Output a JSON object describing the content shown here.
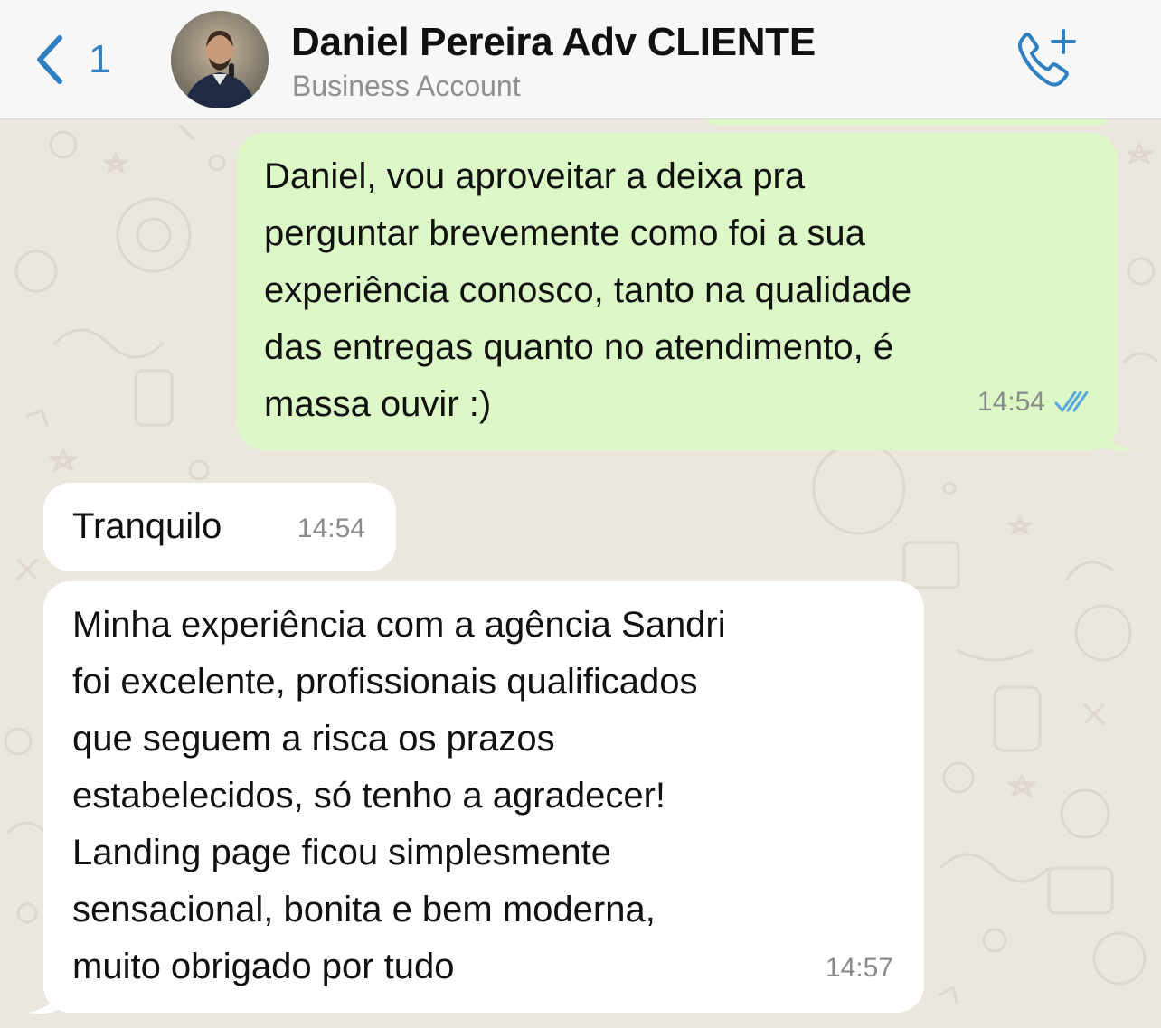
{
  "header": {
    "back_count": "1",
    "contact_name": "Daniel Pereira Adv CLIENTE",
    "contact_subtitle": "Business Account"
  },
  "icons": {
    "back": "chevron-left-icon",
    "call": "phone-plus-icon",
    "read_receipt": "double-check-icon"
  },
  "colors": {
    "accent": "#2f7fc1",
    "outgoing_bubble": "#dcf8c6",
    "incoming_bubble": "#ffffff",
    "chat_background": "#ebe6de",
    "read_ticks": "#5aa7e0"
  },
  "messages": [
    {
      "direction": "out",
      "text": "Daniel, vou aproveitar a deixa pra\nperguntar brevemente como foi a sua\nexperiência conosco, tanto na qualidade\ndas entregas quanto no atendimento, é\nmassa ouvir :)",
      "time": "14:54",
      "status": "read"
    },
    {
      "direction": "in",
      "text": "Tranquilo",
      "time": "14:54"
    },
    {
      "direction": "in",
      "text": "Minha experiência com a agência Sandri\nfoi excelente, profissionais qualificados\nque seguem a risca os prazos\nestabelecidos, só tenho a agradecer!\nLanding page ficou simplesmente\nsensacional, bonita e bem moderna,\nmuito obrigado por tudo",
      "time": "14:57"
    }
  ]
}
